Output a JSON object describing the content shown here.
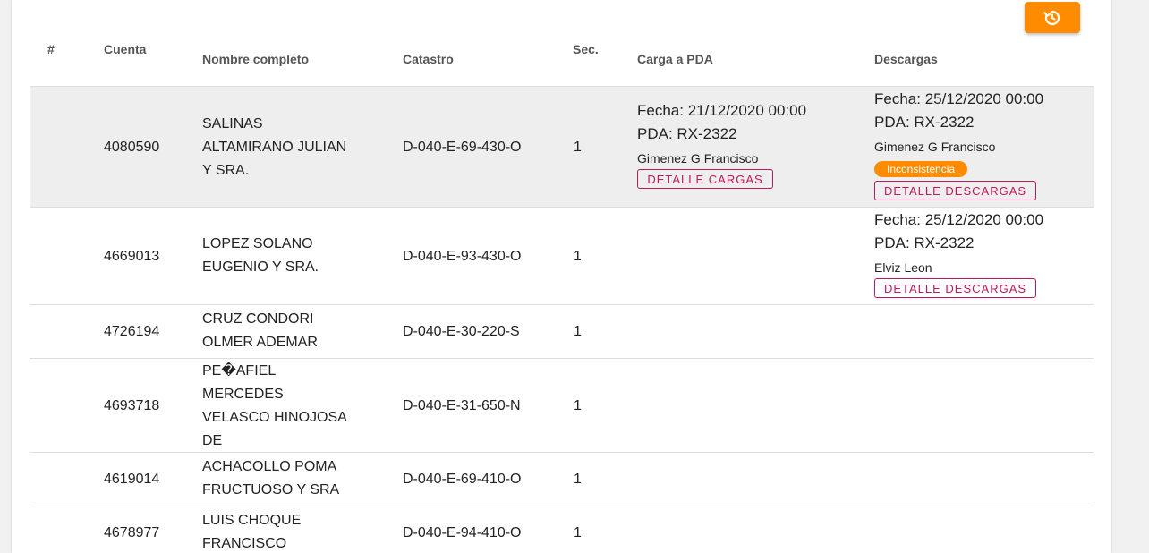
{
  "toolbar": {
    "refresh_icon": "refresh-icon",
    "accent_color": "#ff8c00"
  },
  "table": {
    "headers": {
      "num": "#",
      "cuenta": "Cuenta",
      "nombre": "Nombre completo",
      "catastro": "Catastro",
      "sec": "Sec.",
      "carga": "Carga a PDA",
      "descargas": "Descargas"
    },
    "rows": [
      {
        "cuenta": "4080590",
        "nombre": [
          "SALINAS",
          "ALTAMIRANO JULIAN",
          "Y SRA."
        ],
        "catastro": "D-040-E-69-430-O",
        "sec": "1",
        "carga": {
          "fecha": "Fecha: 21/12/2020 00:00",
          "pda": "PDA: RX-2322",
          "user": "Gimenez G Francisco",
          "button": "DETALLE CARGAS"
        },
        "descarga": {
          "fecha": "Fecha: 25/12/2020 00:00",
          "pda": "PDA: RX-2322",
          "user": "Gimenez G Francisco",
          "badge": "Inconsistencia",
          "button": "DETALLE DESCARGAS"
        }
      },
      {
        "cuenta": "4669013",
        "nombre": [
          "LOPEZ SOLANO",
          "EUGENIO Y SRA."
        ],
        "catastro": "D-040-E-93-430-O",
        "sec": "1",
        "descarga": {
          "fecha": "Fecha: 25/12/2020 00:00",
          "pda": "PDA: RX-2322",
          "user": "Elviz Leon",
          "button": "DETALLE DESCARGAS"
        }
      },
      {
        "cuenta": "4726194",
        "nombre": [
          "CRUZ CONDORI",
          "OLMER ADEMAR"
        ],
        "catastro": "D-040-E-30-220-S",
        "sec": "1"
      },
      {
        "cuenta": "4693718",
        "nombre": [
          "PE�AFIEL",
          "MERCEDES",
          "VELASCO HINOJOSA",
          "DE"
        ],
        "catastro": "D-040-E-31-650-N",
        "sec": "1"
      },
      {
        "cuenta": "4619014",
        "nombre": [
          "ACHACOLLO POMA",
          "FRUCTUOSO Y SRA"
        ],
        "catastro": "D-040-E-69-410-O",
        "sec": "1"
      },
      {
        "cuenta": "4678977",
        "nombre": [
          "LUIS CHOQUE",
          "FRANCISCO"
        ],
        "catastro": "D-040-E-94-410-O",
        "sec": "1"
      }
    ]
  }
}
